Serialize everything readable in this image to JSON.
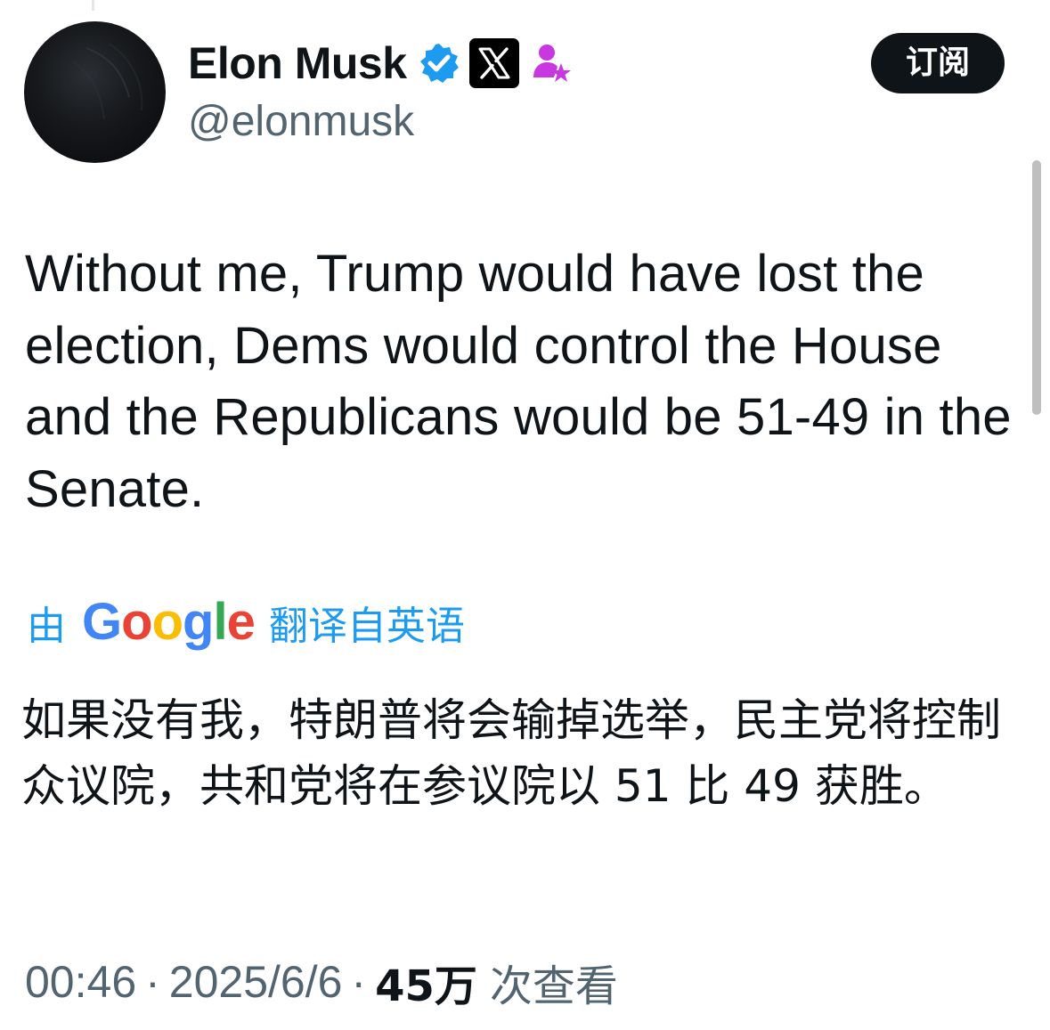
{
  "header": {
    "display_name": "Elon Musk",
    "handle": "@elonmusk",
    "subscribe_label": "订阅",
    "badges": {
      "verified": "verified-checkmark-icon",
      "affiliate": "x-logo-icon",
      "role": "person-star-icon"
    }
  },
  "tweet": {
    "text": "Without me, Trump would have lost the election, Dems would control the House and the Republicans would be 51-49 in the Senate."
  },
  "translation": {
    "prefix": "由",
    "provider": "Google",
    "suffix": "翻译自英语",
    "text": "如果没有我，特朗普将会输掉选举，民主党将控制众议院，共和党将在参议院以 51 比 49 获胜。"
  },
  "meta": {
    "time": "00:46",
    "separator": "·",
    "date": "2025/6/6",
    "views_count": "45万",
    "views_label": "次查看"
  },
  "colors": {
    "accent": "#1d9bf0",
    "text_primary": "#0f1419",
    "text_secondary": "#536471",
    "google_blue": "#4285f4",
    "google_red": "#ea4335",
    "google_yellow": "#fbbc05",
    "google_green": "#34a853",
    "affiliate_purple": "#c837e0"
  }
}
